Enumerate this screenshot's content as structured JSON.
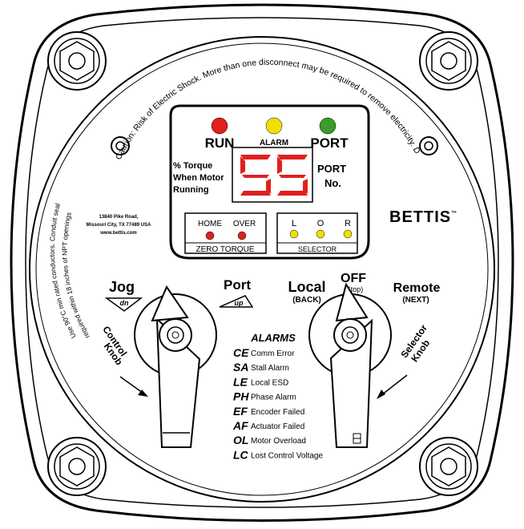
{
  "caution_arc": "Caution: Risk of Electric Shock. More than one disconnect may be required to remove electricity. Do not open even when isolated if flammable atmosphere is present!",
  "conduit_arc_1": "Use 90°C min rated conductors. Conduit seal",
  "conduit_arc_2": "required within 18 inches of NPT openings",
  "address": {
    "line1": "13840 Pike Road,",
    "line2": "Missouri City, TX 77489 USA",
    "line3": "www.bettis.com"
  },
  "brand": {
    "name": "BETTIS",
    "tm": "™"
  },
  "indicators": {
    "run": {
      "label": "RUN",
      "color": "#e0201e"
    },
    "alarm": {
      "label": "ALARM",
      "color": "#f0e000"
    },
    "port": {
      "label": "PORT",
      "color": "#3a9c2a"
    }
  },
  "display": {
    "value": "55",
    "left_label_1": "% Torque",
    "left_label_2": "When Motor",
    "left_label_3": "Running",
    "right_label_1": "PORT",
    "right_label_2": "No.",
    "digit_color": "#e0201e"
  },
  "home_over": {
    "home": "HOME",
    "over": "OVER",
    "bottom": "ZERO TORQUE",
    "led_color": "#e0201e"
  },
  "selector_panel": {
    "l": "L",
    "o": "O",
    "r": "R",
    "bottom": "SELECTOR",
    "led_color": "#f0e000"
  },
  "control": {
    "jog": "Jog",
    "dn": "dn",
    "port": "Port",
    "up": "up",
    "knob_label_1": "Control",
    "knob_label_2": "Knob"
  },
  "selector": {
    "local": "Local",
    "back": "(BACK)",
    "off": "OFF",
    "stop": "(Stop)",
    "remote": "Remote",
    "next": "(NEXT)",
    "knob_label_1": "Selector",
    "knob_label_2": "Knob"
  },
  "alarms": {
    "title": "ALARMS",
    "items": [
      {
        "code": "CE",
        "text": "Comm Error"
      },
      {
        "code": "SA",
        "text": "Stall Alarm"
      },
      {
        "code": "LE",
        "text": "Local ESD"
      },
      {
        "code": "PH",
        "text": "Phase Alarm"
      },
      {
        "code": "EF",
        "text": "Encoder Failed"
      },
      {
        "code": "AF",
        "text": "Actuator Failed"
      },
      {
        "code": "OL",
        "text": "Motor Overload"
      },
      {
        "code": "LC",
        "text": "Lost Control Voltage"
      }
    ]
  }
}
